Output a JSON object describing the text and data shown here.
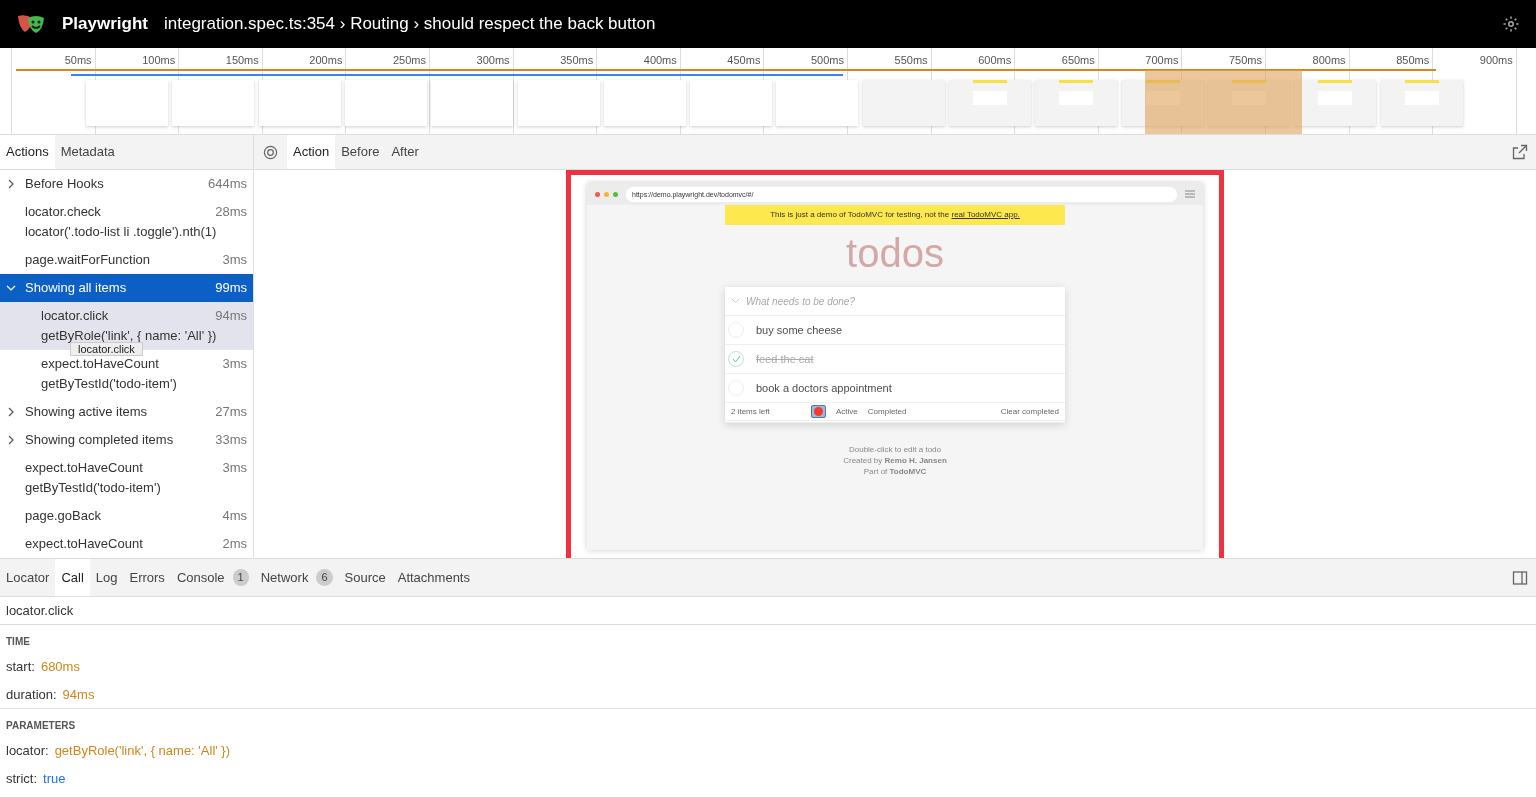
{
  "header": {
    "app": "Playwright",
    "breadcrumb": "integration.spec.ts:354 › Routing › should respect the back button"
  },
  "timeline": {
    "ticks": [
      "50ms",
      "100ms",
      "150ms",
      "200ms",
      "250ms",
      "300ms",
      "350ms",
      "400ms",
      "450ms",
      "500ms",
      "550ms",
      "600ms",
      "650ms",
      "700ms",
      "750ms",
      "800ms",
      "850ms",
      "900ms"
    ]
  },
  "left_tabs": [
    {
      "label": "Actions",
      "selected": true
    },
    {
      "label": "Metadata",
      "selected": false
    }
  ],
  "actions": [
    {
      "title": "Before Hooks",
      "duration": "644ms",
      "selected": false,
      "highlighted": false,
      "expanded": false,
      "has_children": true
    },
    {
      "title": "locator.check",
      "detail": "locator('.todo-list li .toggle').nth(1)",
      "duration": "28ms",
      "selected": false,
      "highlighted": false
    },
    {
      "title": "page.waitForFunction",
      "duration": "3ms",
      "selected": false,
      "highlighted": false
    },
    {
      "title": "Showing all items",
      "duration": "99ms",
      "selected": true,
      "highlighted": false,
      "expanded": true,
      "has_children": true,
      "children": [
        {
          "title": "locator.click",
          "detail": "getByRole('link', { name: 'All' })",
          "duration": "94ms",
          "selected": false,
          "highlighted": true,
          "tooltip": "locator.click"
        },
        {
          "title": "expect.toHaveCount",
          "detail": "getByTestId('todo-item')",
          "duration": "3ms",
          "selected": false,
          "highlighted": false
        }
      ]
    },
    {
      "title": "Showing active items",
      "duration": "27ms",
      "selected": false,
      "highlighted": false,
      "expanded": false,
      "has_children": true
    },
    {
      "title": "Showing completed items",
      "duration": "33ms",
      "selected": false,
      "highlighted": false,
      "expanded": false,
      "has_children": true
    },
    {
      "title": "expect.toHaveCount",
      "detail": "getByTestId('todo-item')",
      "duration": "3ms",
      "selected": false,
      "highlighted": false
    },
    {
      "title": "page.goBack",
      "duration": "4ms",
      "selected": false,
      "highlighted": false
    },
    {
      "title": "expect.toHaveCount",
      "duration": "2ms",
      "selected": false,
      "highlighted": false
    }
  ],
  "snapshot_tabs": [
    {
      "label": "Action",
      "selected": true
    },
    {
      "label": "Before",
      "selected": false
    },
    {
      "label": "After",
      "selected": false
    }
  ],
  "snapshot": {
    "url": "https://demo.playwright.dev/todomvc/#/",
    "banner": "This is just a demo of TodoMVC for testing, not the ",
    "banner_link": "real TodoMVC app.",
    "heading": "todos",
    "placeholder": "What needs to be done?",
    "todos": [
      {
        "text": "buy some cheese",
        "checked": false
      },
      {
        "text": "feed the cat",
        "checked": true
      },
      {
        "text": "book a doctors appointment",
        "checked": false
      }
    ],
    "count": "2 items left",
    "filters": [
      "Active",
      "Completed"
    ],
    "clear": "Clear completed",
    "info": [
      "Double-click to edit a todo",
      "Created by **Remo H. Jansen**",
      "Part of **TodoMVC**"
    ]
  },
  "bottom_tabs": [
    {
      "label": "Locator",
      "selected": false
    },
    {
      "label": "Call",
      "selected": true
    },
    {
      "label": "Log",
      "selected": false
    },
    {
      "label": "Errors",
      "selected": false
    },
    {
      "label": "Console",
      "count": "1",
      "selected": false
    },
    {
      "label": "Network",
      "count": "6",
      "selected": false
    },
    {
      "label": "Source",
      "selected": false
    },
    {
      "label": "Attachments",
      "selected": false
    }
  ],
  "call": {
    "title": "locator.click",
    "sections": [
      {
        "heading": "TIME",
        "rows": [
          {
            "key": "start:",
            "value": "680ms",
            "kind": "text"
          },
          {
            "key": "duration:",
            "value": "94ms",
            "kind": "text"
          }
        ]
      },
      {
        "heading": "PARAMETERS",
        "rows": [
          {
            "key": "locator:",
            "value": "getByRole('link', { name: 'All' })",
            "kind": "text"
          },
          {
            "key": "strict:",
            "value": "true",
            "kind": "keyword"
          }
        ]
      }
    ]
  }
}
